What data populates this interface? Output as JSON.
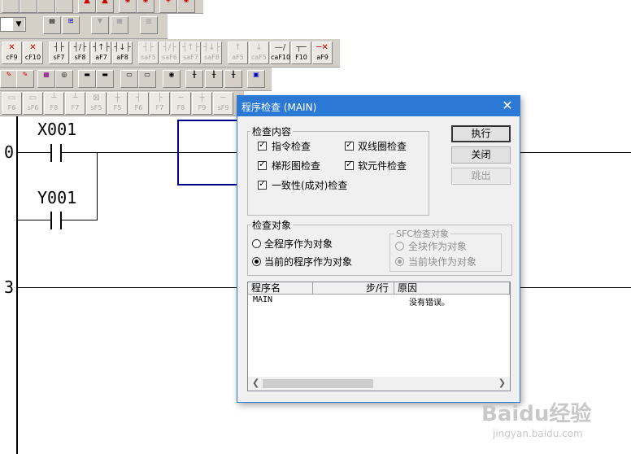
{
  "toolbar_fkeys_row1": [
    "cF9",
    "cF10",
    "sF7",
    "sF8",
    "aF7",
    "aF8",
    "saF5",
    "saF6",
    "saF7",
    "saF8",
    "aF5",
    "caF5",
    "caF10",
    "F10",
    "aF9"
  ],
  "toolbar_fkeys_row2": [
    "F6",
    "sF6",
    "F8",
    "F7",
    "sF5",
    "F5",
    "F6",
    "F7",
    "F8",
    "F9",
    "sF9"
  ],
  "ladder": {
    "step0": "0",
    "step3": "3",
    "contact1": "X001",
    "contact2": "Y001"
  },
  "dialog": {
    "title": "程序检查 (MAIN)",
    "close_glyph": "✕",
    "check_group": {
      "title": "检查内容",
      "items": [
        "指令检查",
        "双线圈检查",
        "梯形图检查",
        "软元件检查",
        "一致性(成对)检查"
      ]
    },
    "buttons": {
      "execute": "执行",
      "close": "关闭",
      "jump": "跳出"
    },
    "target_group": {
      "title": "检查对象",
      "all": "全程序作为对象",
      "current": "当前的程序作为对象"
    },
    "sfc_group": {
      "title": "SFC检查对象",
      "all_block": "全块作为对象",
      "current_block": "当前块作为对象"
    },
    "results": {
      "headers": [
        "程序名",
        "步/行",
        "原因"
      ],
      "rows": [
        {
          "program": "MAIN",
          "step": "",
          "reason": "没有错误。"
        }
      ]
    }
  },
  "watermark": {
    "brand": "Baidu经验",
    "url": "jingyan.baidu.com"
  }
}
